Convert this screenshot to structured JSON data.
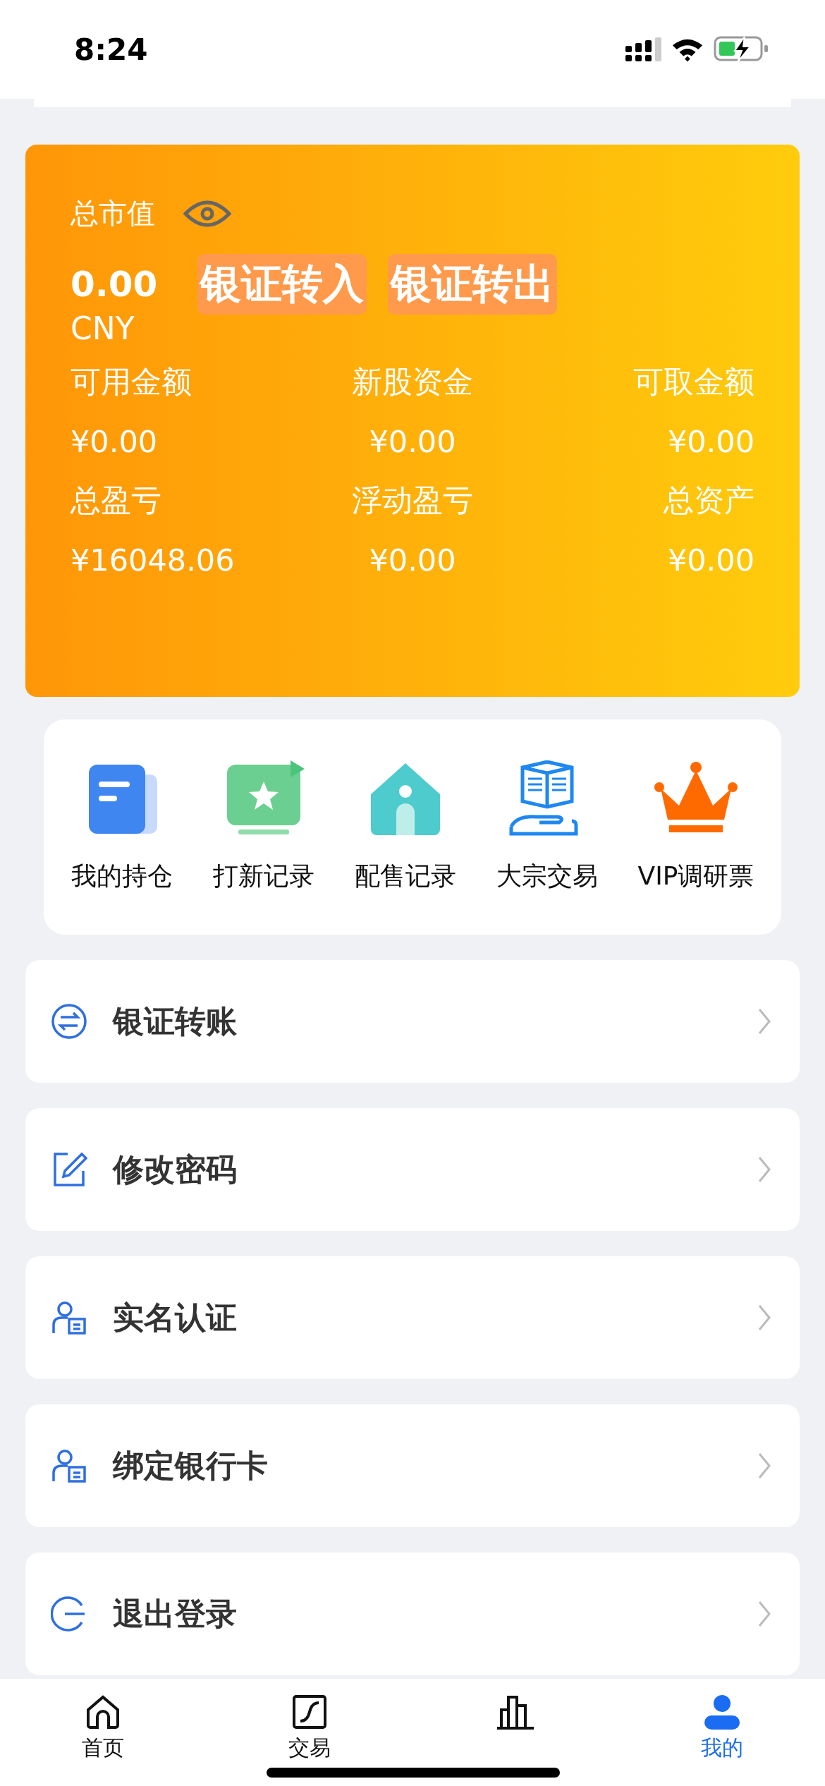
{
  "status_bar": {
    "time": "8:24"
  },
  "assets": {
    "label": "总市值",
    "amount": "0.00",
    "currency": "CNY",
    "actions": [
      "银证转入",
      "银证转出"
    ],
    "stats": [
      {
        "label": "可用金额",
        "value": "¥0.00"
      },
      {
        "label": "新股资金",
        "value": "¥0.00"
      },
      {
        "label": "可取金额",
        "value": "¥0.00"
      },
      {
        "label": "总盈亏",
        "value": "¥16048.06"
      },
      {
        "label": "浮动盈亏",
        "value": "¥0.00"
      },
      {
        "label": "总资产",
        "value": "¥0.00"
      }
    ]
  },
  "shortcuts": [
    {
      "label": "我的持仓",
      "kind": "holdings"
    },
    {
      "label": "打新记录",
      "kind": "ipo"
    },
    {
      "label": "配售记录",
      "kind": "placement"
    },
    {
      "label": "大宗交易",
      "kind": "block"
    },
    {
      "label": "VIP调研票",
      "kind": "vip"
    }
  ],
  "menu": [
    {
      "label": "银证转账",
      "kind": "transfer"
    },
    {
      "label": "修改密码",
      "kind": "password"
    },
    {
      "label": "实名认证",
      "kind": "identity"
    },
    {
      "label": "绑定银行卡",
      "kind": "bankcard"
    },
    {
      "label": "退出登录",
      "kind": "logout"
    }
  ],
  "tabs": [
    {
      "label": "首页",
      "kind": "home",
      "selected": false
    },
    {
      "label": "交易",
      "kind": "trade",
      "selected": false
    },
    {
      "kind": "market",
      "selected": false
    },
    {
      "label": "我的",
      "kind": "profile",
      "selected": true
    }
  ]
}
